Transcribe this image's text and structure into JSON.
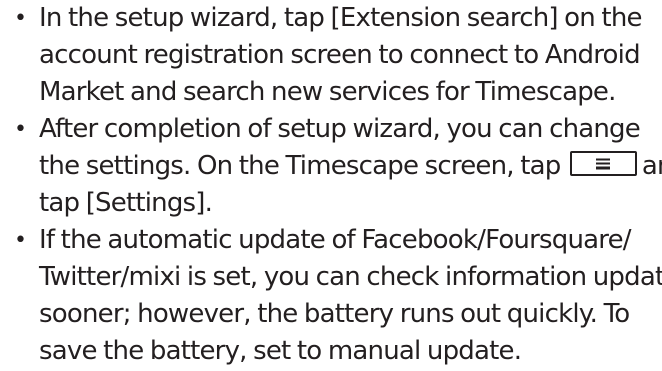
{
  "notes": [
    {
      "bullet": "•",
      "lines": [
        "In the setup wizard, tap [Extension search] on the",
        "account registration screen to connect to Android",
        "Market and search new services for Timescape."
      ]
    },
    {
      "bullet": "•",
      "lines": [
        "After completion of setup wizard, you can change",
        "the settings. On the Timescape screen, tap",
        "and",
        "tap [Settings]."
      ]
    },
    {
      "bullet": "•",
      "lines": [
        "If the automatic update of Facebook/Foursquare/",
        "Twitter/mixi is set, you can check information update",
        "sooner; however, the battery runs out quickly. To",
        "save the battery, set to manual update."
      ]
    }
  ],
  "icons": {
    "menu_key": "menu-key-icon"
  }
}
